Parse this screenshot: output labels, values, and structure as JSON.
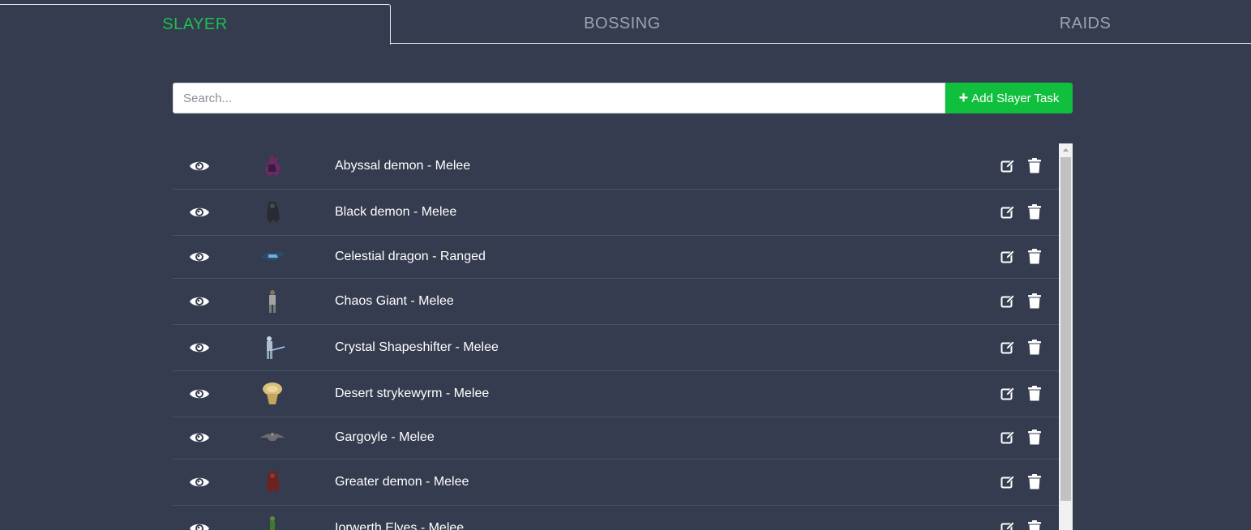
{
  "tabs": [
    {
      "label": "SLAYER",
      "active": true
    },
    {
      "label": "BOSSING",
      "active": false
    },
    {
      "label": "RAIDS",
      "active": false
    }
  ],
  "search": {
    "placeholder": "Search...",
    "value": ""
  },
  "add_button": {
    "label": "Add Slayer Task",
    "icon": "plus-icon"
  },
  "tasks": [
    {
      "label": "Abyssal demon - Melee",
      "thumb": "abyssal-demon"
    },
    {
      "label": "Black demon - Melee",
      "thumb": "black-demon"
    },
    {
      "label": "Celestial dragon - Ranged",
      "thumb": "celestial-dragon"
    },
    {
      "label": "Chaos Giant - Melee",
      "thumb": "chaos-giant"
    },
    {
      "label": "Crystal Shapeshifter - Melee",
      "thumb": "crystal-shapeshifter"
    },
    {
      "label": "Desert strykewyrm - Melee",
      "thumb": "desert-strykewyrm"
    },
    {
      "label": "Gargoyle - Melee",
      "thumb": "gargoyle"
    },
    {
      "label": "Greater demon - Melee",
      "thumb": "greater-demon"
    },
    {
      "label": "Iorwerth Elves - Melee",
      "thumb": "iorwerth-elves"
    }
  ],
  "colors": {
    "background": "#353c4f",
    "accent": "#10bf3d",
    "active_tab": "#1dbf4f",
    "inactive_tab": "#9ea3ae",
    "row_divider": "#4b5264"
  }
}
